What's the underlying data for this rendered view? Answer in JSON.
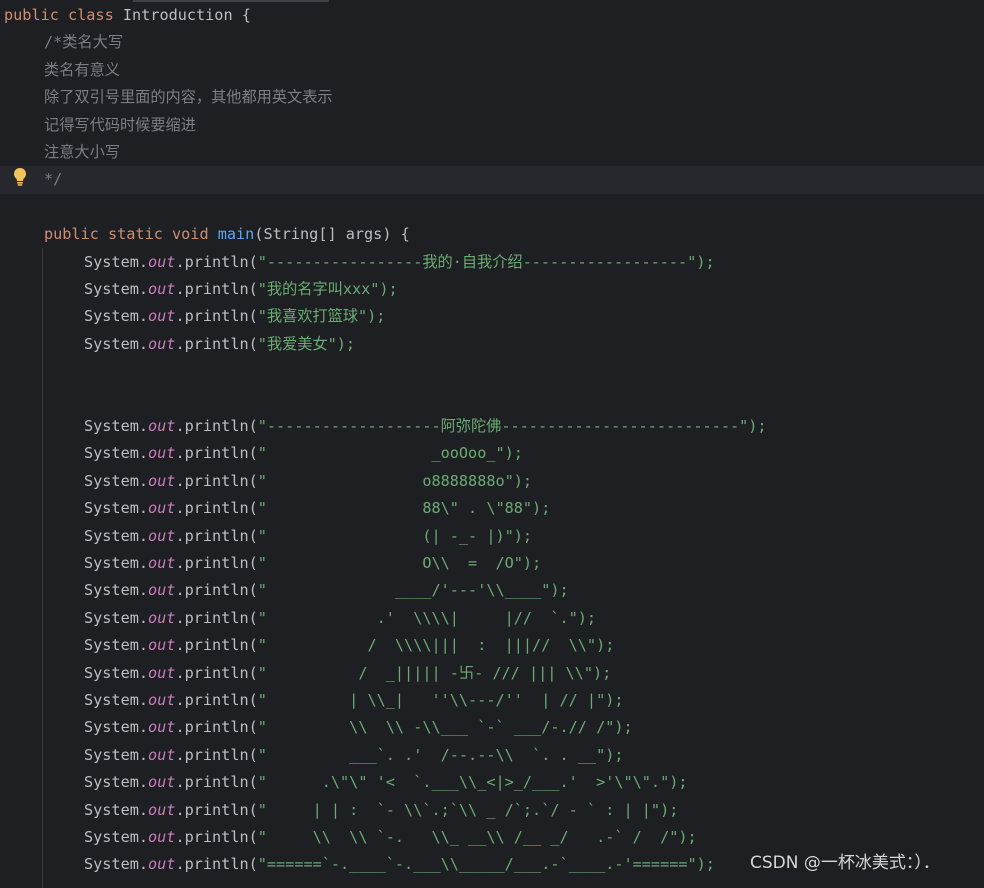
{
  "editor": {
    "lines": [
      {
        "indent": 0,
        "segments": [
          {
            "t": "public class ",
            "c": "kw"
          },
          {
            "t": "Introduction {",
            "c": "pl"
          }
        ]
      },
      {
        "indent": 1,
        "segments": [
          {
            "t": "/*类名大写",
            "c": "cmt"
          }
        ]
      },
      {
        "indent": 1,
        "segments": [
          {
            "t": "类名有意义",
            "c": "cmt"
          }
        ]
      },
      {
        "indent": 1,
        "segments": [
          {
            "t": "除了双引号里面的内容，其他都用英文表示",
            "c": "cmt"
          }
        ]
      },
      {
        "indent": 1,
        "segments": [
          {
            "t": "记得写代码时候要缩进",
            "c": "cmt"
          }
        ]
      },
      {
        "indent": 1,
        "segments": [
          {
            "t": "注意大小写",
            "c": "cmt"
          }
        ]
      },
      {
        "indent": 1,
        "highlight": true,
        "segments": [
          {
            "t": "*/",
            "c": "cmt"
          }
        ]
      },
      {
        "indent": 0,
        "segments": []
      },
      {
        "indent": 1,
        "segments": [
          {
            "t": "public static void ",
            "c": "kw"
          },
          {
            "t": "main",
            "c": "fn"
          },
          {
            "t": "(String[] args) {",
            "c": "pl"
          }
        ]
      },
      {
        "indent": 2,
        "println": "\"-----------------我的·自我介绍------------------\");"
      },
      {
        "indent": 2,
        "println": "\"我的名字叫xxx\");"
      },
      {
        "indent": 2,
        "println": "\"我喜欢打篮球\");"
      },
      {
        "indent": 2,
        "println": "\"我爱美女\");"
      },
      {
        "indent": 0,
        "segments": []
      },
      {
        "indent": 0,
        "segments": []
      },
      {
        "indent": 2,
        "println": "\"-------------------阿弥陀佛--------------------------\");"
      },
      {
        "indent": 2,
        "println": "\"                  _ooOoo_\");"
      },
      {
        "indent": 2,
        "println": "\"                 o8888888o\");"
      },
      {
        "indent": 2,
        "println": "\"                 88\\\" . \\\"88\");"
      },
      {
        "indent": 2,
        "println": "\"                 (| -_- |)\");"
      },
      {
        "indent": 2,
        "println": "\"                 O\\\\  =  /O\");"
      },
      {
        "indent": 2,
        "println": "\"              ____/'---'\\\\____\");"
      },
      {
        "indent": 2,
        "println": "\"            .'  \\\\\\\\|     |//  `.\");"
      },
      {
        "indent": 2,
        "println": "\"           /  \\\\\\\\|||  :  |||//  \\\\\");"
      },
      {
        "indent": 2,
        "println": "\"          /  _||||| -卐- /// ||| \\\\\");"
      },
      {
        "indent": 2,
        "println": "\"         | \\\\_|   ''\\\\---/''  | // |\");"
      },
      {
        "indent": 2,
        "println": "\"         \\\\  \\\\ -\\\\___ `-` ___/-.// /\");"
      },
      {
        "indent": 2,
        "println": "\"         ___`. .'  /--.--\\\\  `. . __\");"
      },
      {
        "indent": 2,
        "println": "\"      .\\\"\\\" '<  `.___\\\\_<|>_/___.'  >'\\\"\\\".\");"
      },
      {
        "indent": 2,
        "println": "\"     | | :  `- \\\\`.;`\\\\ _ /`;.`/ - ` : | |\");"
      },
      {
        "indent": 2,
        "println": "\"     \\\\  \\\\ `-.   \\\\_ __\\\\ /__ _/   .-` /  /\");"
      },
      {
        "indent": 2,
        "println": "\"======`-.____`-.___\\\\_____/___.-`____.-'======\");"
      }
    ],
    "call_prefix": "System.",
    "call_field": "out",
    "call_method": ".println(",
    "gutter_icon": "lightbulb-icon"
  },
  "watermark": "CSDN @一杯冰美式：）．",
  "colors": {
    "background": "#1e1f22",
    "keyword": "#cf8e6d",
    "method": "#56a8f5",
    "field": "#c77dbb",
    "string": "#6aab73",
    "comment": "#7a7e85",
    "plain": "#bcbec4"
  }
}
